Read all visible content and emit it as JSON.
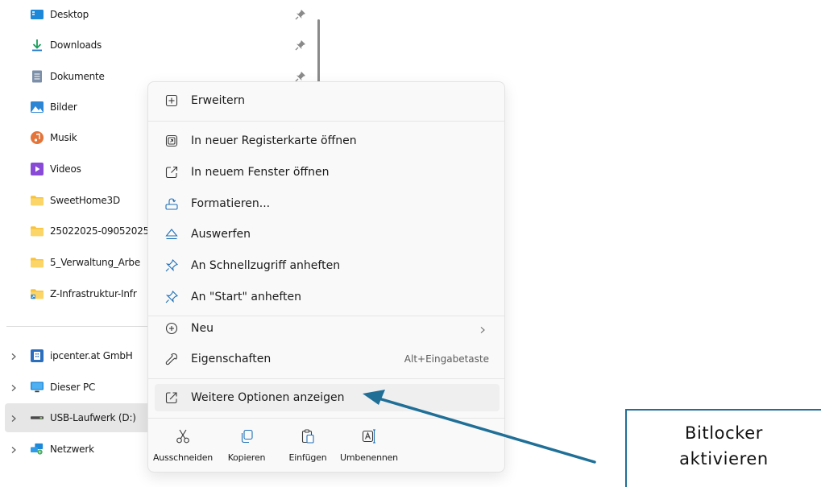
{
  "nav": {
    "quick_access": [
      {
        "label": "Desktop",
        "icon": "desktop-icon"
      },
      {
        "label": "Downloads",
        "icon": "download-icon"
      },
      {
        "label": "Dokumente",
        "icon": "document-icon"
      },
      {
        "label": "Bilder",
        "icon": "pictures-icon"
      },
      {
        "label": "Musik",
        "icon": "music-icon"
      },
      {
        "label": "Videos",
        "icon": "video-icon"
      },
      {
        "label": "SweetHome3D",
        "icon": "folder-icon"
      },
      {
        "label": "25022025-09052025",
        "icon": "folder-icon"
      },
      {
        "label": "5_Verwaltung_Arbe",
        "icon": "folder-icon"
      },
      {
        "label": "Z-Infrastruktur-Infr",
        "icon": "folder-shortcut-icon"
      }
    ],
    "locations": [
      {
        "label": "ipcenter.at GmbH",
        "icon": "onedrive-business-icon"
      },
      {
        "label": "Dieser PC",
        "icon": "computer-icon"
      },
      {
        "label": "USB-Laufwerk (D:)",
        "icon": "usb-drive-icon",
        "selected": true
      },
      {
        "label": "Netzwerk",
        "icon": "network-icon"
      }
    ]
  },
  "menu": {
    "items": [
      {
        "label": "Erweitern",
        "icon": "expand-icon"
      },
      {
        "label": "In neuer Registerkarte öffnen",
        "icon": "new-tab-icon"
      },
      {
        "label": "In neuem Fenster öffnen",
        "icon": "new-window-icon"
      },
      {
        "label": "Formatieren...",
        "icon": "format-icon"
      },
      {
        "label": "Auswerfen",
        "icon": "eject-icon"
      },
      {
        "label": "An Schnellzugriff anheften",
        "icon": "pin-icon"
      },
      {
        "label": "An \"Start\" anheften",
        "icon": "pin-icon"
      },
      {
        "label": "Neu",
        "icon": "new-icon"
      },
      {
        "label": "Eigenschaften",
        "icon": "properties-icon",
        "shortcut": "Alt+Eingabetaste"
      },
      {
        "label": "Weitere Optionen anzeigen",
        "icon": "more-options-icon"
      }
    ],
    "quick_actions": [
      {
        "label": "Ausschneiden",
        "icon": "cut-icon"
      },
      {
        "label": "Kopieren",
        "icon": "copy-icon"
      },
      {
        "label": "Einfügen",
        "icon": "paste-icon"
      },
      {
        "label": "Umbenennen",
        "icon": "rename-icon"
      }
    ]
  },
  "callout": {
    "line1": "Bitlocker",
    "line2": "aktivieren"
  },
  "colors": {
    "accent": "#1f6f97",
    "menu_bg": "#f9f9f9",
    "hover": "#efefef",
    "selected": "#e6e6e6",
    "folder": "#f8c33b"
  }
}
